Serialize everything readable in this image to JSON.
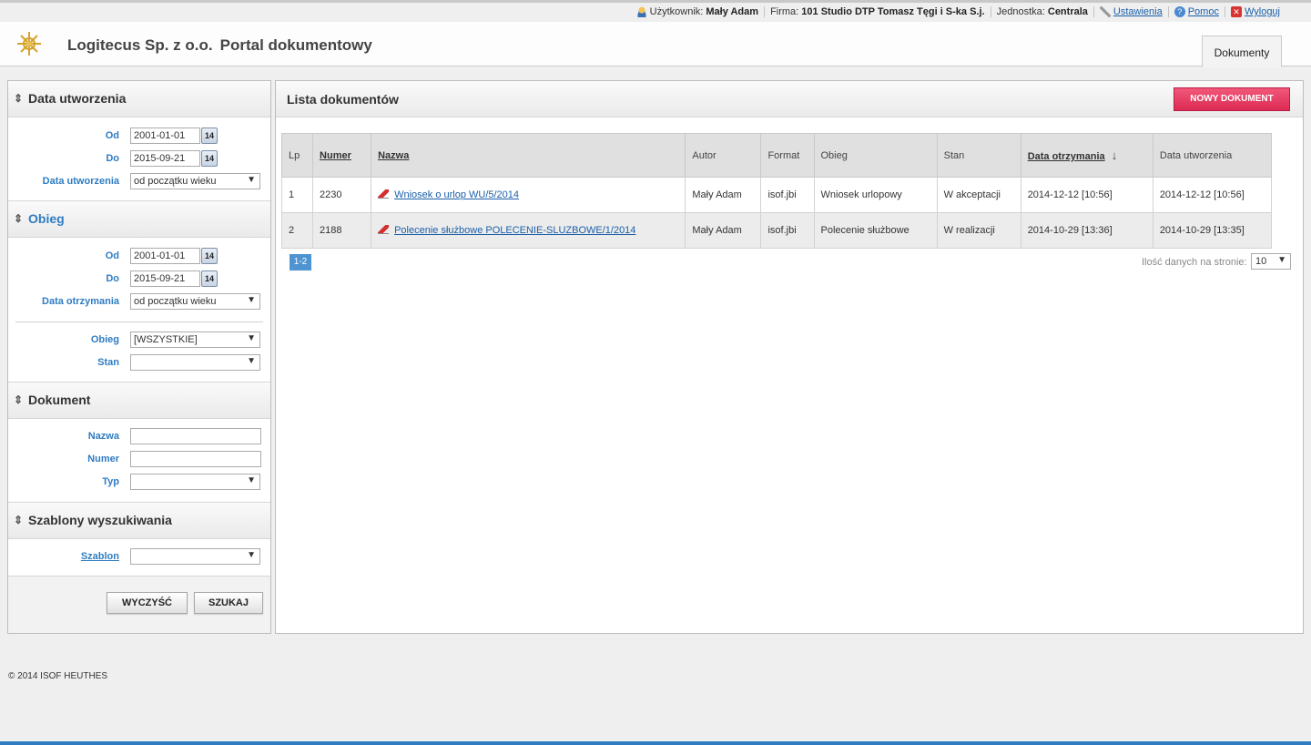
{
  "topbar": {
    "user_label": "Użytkownik:",
    "user_value": "Mały Adam",
    "firm_label": "Firma:",
    "firm_value": "101 Studio DTP Tomasz Tęgi i S-ka S.j.",
    "unit_label": "Jednostka:",
    "unit_value": "Centrala",
    "settings": "Ustawienia",
    "help": "Pomoc",
    "logout": "Wyloguj"
  },
  "header": {
    "company": "Logitecus Sp. z o.o.",
    "portal": "Portal dokumentowy",
    "tab": "Dokumenty"
  },
  "filters": {
    "creation": {
      "title": "Data utworzenia",
      "from_label": "Od",
      "from_value": "2001-01-01",
      "to_label": "Do",
      "to_value": "2015-09-21",
      "range_label": "Data utworzenia",
      "range_value": "od początku wieku"
    },
    "flow": {
      "title": "Obieg",
      "from_label": "Od",
      "from_value": "2001-01-01",
      "to_label": "Do",
      "to_value": "2015-09-21",
      "range_label": "Data otrzymania",
      "range_value": "od początku wieku",
      "flow_label": "Obieg",
      "flow_value": "[WSZYSTKIE]",
      "state_label": "Stan",
      "state_value": ""
    },
    "document": {
      "title": "Dokument",
      "name_label": "Nazwa",
      "name_value": "",
      "number_label": "Numer",
      "number_value": "",
      "type_label": "Typ",
      "type_value": ""
    },
    "templates": {
      "title": "Szablony wyszukiwania",
      "template_label": "Szablon",
      "template_value": ""
    },
    "calendar_day": "14",
    "clear_button": "WYCZYŚĆ",
    "search_button": "SZUKAJ"
  },
  "main": {
    "title": "Lista dokumentów",
    "new_button": "NOWY DOKUMENT",
    "columns": [
      "Lp",
      "Numer",
      "Nazwa",
      "Autor",
      "Format",
      "Obieg",
      "Stan",
      "Data otrzymania",
      "Data utworzenia"
    ],
    "sort_arrow": "↓",
    "rows": [
      {
        "lp": "1",
        "numer": "2230",
        "nazwa": "Wniosek o urlop WU/5/2014",
        "autor": "Mały Adam",
        "format": "isof.jbi",
        "obieg": "Wniosek urlopowy",
        "stan": "W akceptacji",
        "data_otrzymania": "2014-12-12 [10:56]",
        "data_utworzenia": "2014-12-12 [10:56]"
      },
      {
        "lp": "2",
        "numer": "2188",
        "nazwa": "Polecenie służbowe POLECENIE-SLUZBOWE/1/2014",
        "autor": "Mały Adam",
        "format": "isof.jbi",
        "obieg": "Polecenie służbowe",
        "stan": "W realizacji",
        "data_otrzymania": "2014-10-29 [13:36]",
        "data_utworzenia": "2014-10-29 [13:35]"
      }
    ],
    "pager": "1-2",
    "per_page_label": "Ilość danych na stronie:",
    "per_page_value": "10"
  },
  "footer": "© 2014 ISOF HEUTHES",
  "colors": {
    "accent_blue": "#2f7cc2",
    "new_button": "#dc2a53",
    "link": "#1a5fa8"
  }
}
